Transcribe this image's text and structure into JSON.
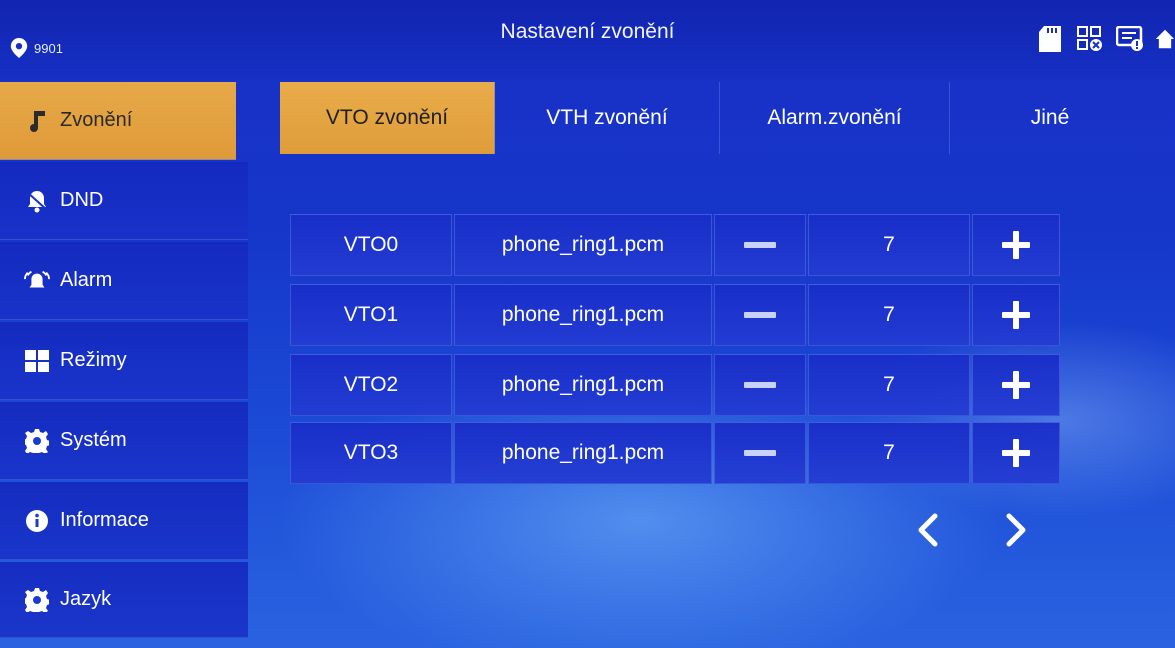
{
  "header": {
    "location_label": "9901",
    "title": "Nastavení zvonění",
    "status_icons": [
      "sd-card-icon",
      "network-error-icon",
      "message-icon",
      "home-icon"
    ]
  },
  "sidebar": {
    "items": [
      {
        "label": "Zvonění",
        "icon": "music-note-icon",
        "active": true
      },
      {
        "label": "DND",
        "icon": "bell-mute-icon",
        "active": false
      },
      {
        "label": "Alarm",
        "icon": "alarm-bell-icon",
        "active": false
      },
      {
        "label": "Režimy",
        "icon": "grid-icon",
        "active": false
      },
      {
        "label": "Systém",
        "icon": "gear-icon",
        "active": false
      },
      {
        "label": "Informace",
        "icon": "info-icon",
        "active": false
      },
      {
        "label": "Jazyk",
        "icon": "gear-icon",
        "active": false
      }
    ]
  },
  "tabs": [
    {
      "label": "VTO zvonění",
      "active": true
    },
    {
      "label": "VTH zvonění",
      "active": false
    },
    {
      "label": "Alarm.zvonění",
      "active": false
    },
    {
      "label": "Jiné",
      "active": false
    }
  ],
  "rows": [
    {
      "device": "VTO0",
      "ringtone": "phone_ring1.pcm",
      "volume": "7"
    },
    {
      "device": "VTO1",
      "ringtone": "phone_ring1.pcm",
      "volume": "7"
    },
    {
      "device": "VTO2",
      "ringtone": "phone_ring1.pcm",
      "volume": "7"
    },
    {
      "device": "VTO3",
      "ringtone": "phone_ring1.pcm",
      "volume": "7"
    }
  ],
  "colors": {
    "accent": "#e3a140",
    "background": "#1a3ad0",
    "cell": "#1e36c8"
  }
}
